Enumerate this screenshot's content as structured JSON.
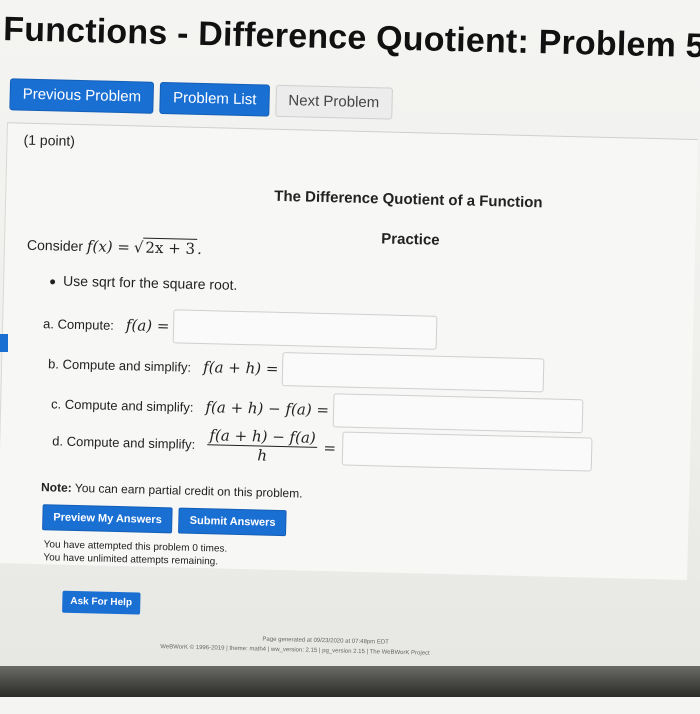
{
  "page": {
    "title": "Functions - Difference Quotient: Problem 5"
  },
  "nav": {
    "previous": "Previous Problem",
    "list": "Problem List",
    "next": "Next Problem"
  },
  "problem": {
    "points": "(1 point)",
    "heading": "The Difference Quotient of a Function",
    "subheading": "Practice",
    "consider_label": "Consider",
    "function_lhs": "f(x) =",
    "function_radicand": "2x + 3",
    "function_tail": ".",
    "bullet": "Use sqrt for the square root.",
    "parts": [
      {
        "label": "a. Compute:",
        "expr": "f(a) =",
        "value": ""
      },
      {
        "label": "b. Compute and simplify:",
        "expr": "f(a + h) =",
        "value": ""
      },
      {
        "label": "c. Compute and simplify:",
        "expr": "f(a + h) − f(a) =",
        "value": ""
      },
      {
        "label": "d. Compute and simplify:",
        "expr_num": "f(a + h) − f(a)",
        "expr_den": "h",
        "expr_eq": "=",
        "value": ""
      }
    ],
    "note_bold": "Note:",
    "note_text": "You can earn partial credit on this problem."
  },
  "actions": {
    "preview": "Preview My Answers",
    "submit": "Submit Answers"
  },
  "status": {
    "attempted": "You have attempted this problem 0 times.",
    "remaining": "You have unlimited attempts remaining."
  },
  "help": {
    "label": "Ask For Help"
  },
  "footer": {
    "line1": "Page generated at 09/23/2020 at 07:48pm EDT",
    "line2": "WeBWorK © 1996-2019 | theme: math4 | ww_version: 2.15 | pg_version 2.15 | The WeBWorK Project"
  },
  "colors": {
    "accent": "#1a6fd3",
    "button_gray": "#ececec"
  }
}
